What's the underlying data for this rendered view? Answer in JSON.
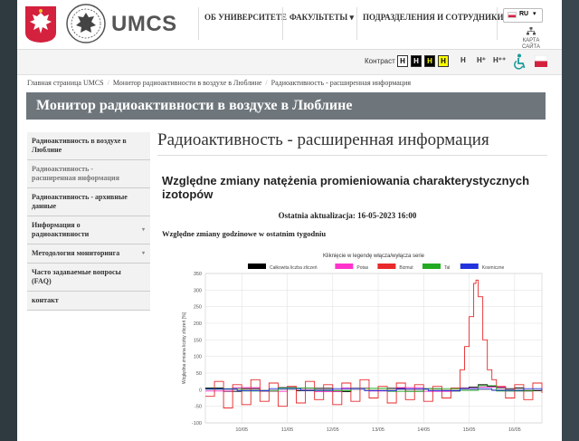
{
  "brand": {
    "name": "UMCS"
  },
  "nav": [
    {
      "label": "ОБ УНИВЕРСИТЕТЕ"
    },
    {
      "label": "ФАКУЛЬТЕТЫ ▾"
    },
    {
      "label": "ПОДРАЗДЕЛЕНИЯ И СОТРУДНИКИ"
    }
  ],
  "lang": {
    "code": "RU"
  },
  "sitemap": {
    "line1": "КАРТА",
    "line2": "САЙТА"
  },
  "accessibility": {
    "contrast_label": "Контраст",
    "contrast_buttons": [
      "Н",
      "Н",
      "Н",
      "Н"
    ],
    "font_sizes": [
      "Н",
      "Н⁺",
      "Н⁺⁺"
    ]
  },
  "breadcrumb": [
    "Главная страница UMCS",
    "Монитор радиоактивности в воздухе в Люблине",
    "Радиоактивность - расширенная информация"
  ],
  "page_title": "Монитор радиоактивности в воздухе в Люблине",
  "sidebar": [
    {
      "label": "Радиоактивность в воздухе в Люблине",
      "sub": false,
      "arrow": ""
    },
    {
      "label": "Радиоактивность - расширенная информация",
      "sub": true,
      "arrow": ""
    },
    {
      "label": "Радиоактивность - архивные данные",
      "sub": false,
      "arrow": ""
    },
    {
      "label": "Информация о радиоактивности",
      "sub": false,
      "arrow": "▾"
    },
    {
      "label": "Методология мониторинга",
      "sub": false,
      "arrow": "▾"
    },
    {
      "label": "Часто задаваемые вопросы (FAQ)",
      "sub": false,
      "arrow": ""
    },
    {
      "label": "контакт",
      "sub": false,
      "arrow": ""
    }
  ],
  "content": {
    "heading": "Радиоактивность - расширенная информация",
    "section_title": "Względne zmiany natężenia promieniowania charakterystycznych izotopów",
    "updated": "Ostatnia aktualizacja: 16-05-2023 16:00",
    "subtitle": "Względne zmiany godzinowe w ostatnim tygodniu"
  },
  "chart_data": {
    "type": "line",
    "title": "Kliknięcie w legendę włącza/wyłącza serie",
    "ylabel": "Względna zmiana liczby zliczeń [%]",
    "ylim": [
      -100,
      350
    ],
    "yticks": [
      -100,
      -50,
      0,
      50,
      100,
      150,
      200,
      250,
      300,
      350
    ],
    "x_tick_labels": [
      "10/05",
      "11/05",
      "12/05",
      "13/05",
      "14/05",
      "15/05",
      "16/05"
    ],
    "x_tick_positions": [
      1,
      2,
      3,
      4,
      5,
      6,
      7
    ],
    "xlim": [
      0.2,
      7.6
    ],
    "grid": true,
    "legend_position": "top",
    "series": [
      {
        "name": "Całkowita liczba zliczeń",
        "color": "#000000",
        "x": [
          0.2,
          0.6,
          1.0,
          1.4,
          1.8,
          2.2,
          2.6,
          3.0,
          3.4,
          3.8,
          4.2,
          4.6,
          5.0,
          5.4,
          5.8,
          6.0,
          6.2,
          6.4,
          6.6,
          6.8,
          7.0,
          7.2,
          7.6
        ],
        "y": [
          5,
          -5,
          3,
          -4,
          6,
          -3,
          4,
          -6,
          5,
          -3,
          4,
          -5,
          3,
          -4,
          5,
          8,
          15,
          10,
          6,
          3,
          5,
          -3,
          4
        ]
      },
      {
        "name": "Potas",
        "color": "#ff33cc",
        "x": [
          0.2,
          0.8,
          1.4,
          2.0,
          2.6,
          3.2,
          3.8,
          4.4,
          5.0,
          5.6,
          6.2,
          6.8,
          7.4
        ],
        "y": [
          -4,
          6,
          -5,
          4,
          -6,
          5,
          -4,
          6,
          -5,
          4,
          8,
          -4,
          5
        ]
      },
      {
        "name": "Bizmut",
        "color": "#e8282a",
        "x": [
          0.2,
          0.4,
          0.6,
          0.8,
          1.0,
          1.2,
          1.4,
          1.6,
          1.8,
          2.0,
          2.2,
          2.4,
          2.6,
          2.8,
          3.0,
          3.2,
          3.4,
          3.6,
          3.8,
          4.0,
          4.2,
          4.4,
          4.6,
          4.8,
          5.0,
          5.2,
          5.4,
          5.6,
          5.8,
          5.9,
          6.0,
          6.1,
          6.15,
          6.2,
          6.3,
          6.4,
          6.5,
          6.6,
          6.8,
          7.0,
          7.2,
          7.4,
          7.6
        ],
        "y": [
          -20,
          25,
          -55,
          15,
          -45,
          30,
          -35,
          20,
          -50,
          10,
          -40,
          25,
          -30,
          15,
          -45,
          20,
          -35,
          30,
          -25,
          10,
          -40,
          20,
          -30,
          15,
          -35,
          10,
          -25,
          5,
          60,
          130,
          220,
          320,
          330,
          280,
          150,
          60,
          30,
          10,
          -25,
          15,
          -30,
          20,
          -10
        ]
      },
      {
        "name": "Tal",
        "color": "#22aa22",
        "x": [
          0.2,
          1.0,
          1.8,
          2.6,
          3.4,
          4.2,
          5.0,
          5.8,
          6.2,
          6.6,
          7.4
        ],
        "y": [
          3,
          -4,
          5,
          -3,
          4,
          -5,
          3,
          -2,
          12,
          -4,
          3
        ]
      },
      {
        "name": "Kosmiczne",
        "color": "#2233dd",
        "x": [
          0.2,
          0.9,
          1.6,
          2.3,
          3.0,
          3.7,
          4.4,
          5.1,
          5.8,
          6.5,
          7.2,
          7.6
        ],
        "y": [
          2,
          -3,
          3,
          -2,
          3,
          -3,
          2,
          -3,
          3,
          -2,
          3,
          -2
        ]
      }
    ]
  },
  "colors": {
    "title_bar": "#6e767c",
    "sidebar_bg": "#f2f2f2"
  }
}
